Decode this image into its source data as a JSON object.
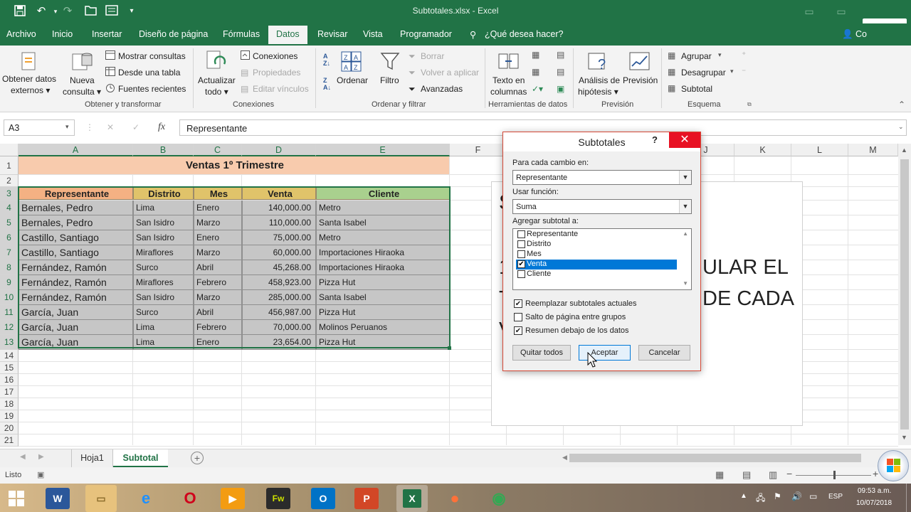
{
  "titlebar": {
    "title": "Subtotales.xlsx - Excel",
    "save": "💾",
    "undo": "↶",
    "redo": "↷",
    "open": "📂",
    "form": "▤",
    "more": "⌄"
  },
  "tabs": [
    {
      "label": "Archivo"
    },
    {
      "label": "Inicio"
    },
    {
      "label": "Insertar"
    },
    {
      "label": "Diseño de página"
    },
    {
      "label": "Fórmulas"
    },
    {
      "label": "Datos"
    },
    {
      "label": "Revisar"
    },
    {
      "label": "Vista"
    },
    {
      "label": "Programador"
    },
    {
      "label": "¿Qué desea hacer?"
    }
  ],
  "user_partial": "Co",
  "ribbon": {
    "obtener_datos": [
      "Obtener datos",
      "externos ▾"
    ],
    "nueva_consulta": [
      "Nueva",
      "consulta ▾"
    ],
    "mostrar_consultas": "Mostrar consultas",
    "desde_tabla": "Desde una tabla",
    "fuentes_recientes": "Fuentes recientes",
    "g1": "Obtener y transformar",
    "actualizar": [
      "Actualizar",
      "todo ▾"
    ],
    "conexiones": "Conexiones",
    "propiedades": "Propiedades",
    "editar_vinculos": "Editar vínculos",
    "g2": "Conexiones",
    "ordenar": "Ordenar",
    "filtro": "Filtro",
    "borrar": "Borrar",
    "volver_aplicar": "Volver a aplicar",
    "avanzadas": "Avanzadas",
    "g3": "Ordenar y filtrar",
    "texto_columnas": [
      "Texto en",
      "columnas"
    ],
    "g4": "Herramientas de datos",
    "analisis": [
      "Análisis de",
      "hipótesis ▾"
    ],
    "prevision": "Previsión",
    "g5": "Previsión",
    "agrupar": "Agrupar",
    "desagrupar": "Desagrupar",
    "subtotal": "Subtotal",
    "g6": "Esquema"
  },
  "formula": {
    "namebox": "A3",
    "fx": "fx",
    "value": "Representante",
    "cancel": "✕",
    "enter": "✓"
  },
  "columns": [
    "A",
    "B",
    "C",
    "D",
    "E",
    "F",
    "G",
    "H",
    "I",
    "J",
    "K",
    "L",
    "M"
  ],
  "rows": [
    "1",
    "2",
    "3",
    "4",
    "5",
    "6",
    "7",
    "8",
    "9",
    "10",
    "11",
    "12",
    "13",
    "14",
    "15",
    "16",
    "17",
    "18",
    "19",
    "20",
    "21"
  ],
  "sheet": {
    "title": "Ventas 1º Trimestre",
    "headers": [
      "Representante",
      "Distrito",
      "Mes",
      "Venta",
      "Cliente"
    ],
    "data": [
      [
        "Bernales, Pedro",
        "Lima",
        "Enero",
        "140,000.00",
        "Metro"
      ],
      [
        "Bernales, Pedro",
        "San Isidro",
        "Marzo",
        "110,000.00",
        "Santa Isabel"
      ],
      [
        "Castillo, Santiago",
        "San Isidro",
        "Enero",
        "75,000.00",
        "Metro"
      ],
      [
        "Castillo, Santiago",
        "Miraflores",
        "Marzo",
        "60,000.00",
        "Importaciones Hiraoka"
      ],
      [
        "Fernández, Ramón",
        "Surco",
        "Abril",
        "45,268.00",
        "Importaciones Hiraoka"
      ],
      [
        "Fernández, Ramón",
        "Miraflores",
        "Febrero",
        "458,923.00",
        "Pizza Hut"
      ],
      [
        "Fernández, Ramón",
        "San Isidro",
        "Marzo",
        "285,000.00",
        "Santa Isabel"
      ],
      [
        "García, Juan",
        "Surco",
        "Abril",
        "456,987.00",
        "Pizza Hut"
      ],
      [
        "García, Juan",
        "Lima",
        "Febrero",
        "70,000.00",
        "Molinos Peruanos"
      ],
      [
        "García, Juan",
        "Lima",
        "Enero",
        "23,654.00",
        "Pizza Hut"
      ]
    ]
  },
  "slide_text": [
    "S",
    "1",
    "ULAR  EL",
    "T",
    "DE CADA",
    "V"
  ],
  "dialog": {
    "title": "Subtotales",
    "help": "?",
    "close": "✕",
    "label_cambio": "Para cada cambio en:",
    "cambio_value": "Representante",
    "label_funcion": "Usar función:",
    "funcion_value": "Suma",
    "label_agregar": "Agregar subtotal a:",
    "list": [
      {
        "label": "Representante",
        "checked": false
      },
      {
        "label": "Distrito",
        "checked": false
      },
      {
        "label": "Mes",
        "checked": false
      },
      {
        "label": "Venta",
        "checked": true
      },
      {
        "label": "Cliente",
        "checked": false
      }
    ],
    "reemplazar": "Reemplazar subtotales actuales",
    "salto": "Salto de página entre grupos",
    "resumen": "Resumen debajo de los datos",
    "quitar": "Quitar todos",
    "aceptar": "Aceptar",
    "cancelar": "Cancelar"
  },
  "sheet_tabs": [
    "Hoja1",
    "Subtotal"
  ],
  "status": {
    "ready": "Listo"
  },
  "taskbar": {
    "lang": "ESP",
    "time": "09:53 a.m.",
    "date": "10/07/2018"
  },
  "colors": {
    "excel_green": "#217346",
    "header_orange": "#f8cbad",
    "header_yellow": "#e0c36a",
    "header_green": "#a9d08e",
    "selection_gray": "#c6c6c6"
  }
}
